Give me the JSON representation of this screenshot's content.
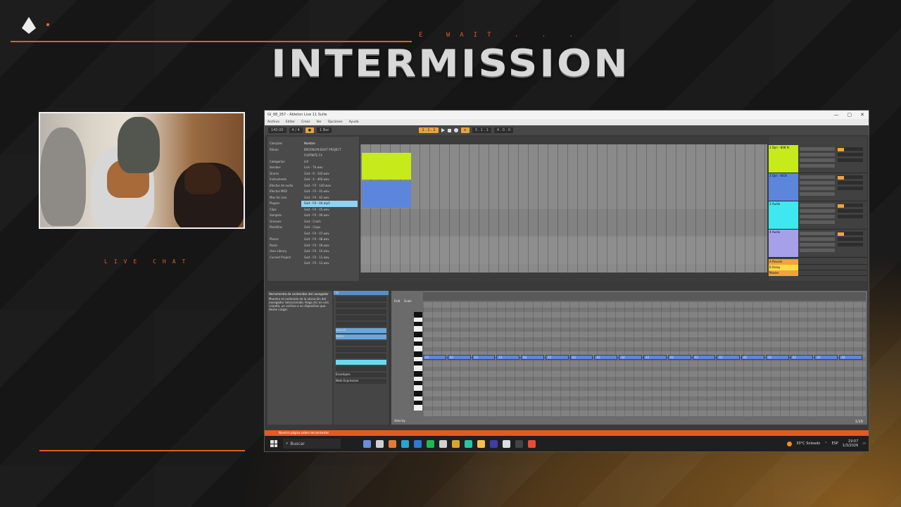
{
  "overlay": {
    "subtitle": "E WAIT . . .",
    "title": "INTERMISSION",
    "live_chat": "LIVE CHAT",
    "accent_color": "#e45b22"
  },
  "window": {
    "title": "Gl_98_267 - Ableton Live 11 Suite",
    "controls": [
      "—",
      "▢",
      "✕"
    ]
  },
  "menu": [
    "Archivo",
    "Editar",
    "Crear",
    "Ver",
    "Opciones",
    "Ayuda"
  ],
  "transport": {
    "tempo": "140.00",
    "signature": "4 / 4",
    "position": "1 . 1 . 1",
    "loop_start": "3 . 1 . 1",
    "loop_length": "4 . 0 . 0",
    "quantize": "1 Bar"
  },
  "browser": {
    "categories": [
      "Coleções",
      "Rótulo",
      "",
      "Categorías",
      "Sonidos",
      "Drums",
      "Instruments",
      "Efectos de audio",
      "Efectos MIDI",
      "Max for Live",
      "Plugins",
      "Clips",
      "Samples",
      "Grooves",
      "Plantillas",
      "",
      "Places",
      "Packs",
      "User Library",
      "Current Project"
    ],
    "files_header": "Nombre",
    "files": [
      "BROOKLYN BUUT PROJECT",
      "FORTNITE FX",
      "LIX",
      "Lion - Tb.wav",
      "Gait - 6 - 140.wav",
      "Gait - 4 - 460.wav",
      "Gait - FX - 140.wav",
      "Gait - FX - 01.wav",
      "Gait - FX - 02.wav",
      "Gait - FX - 04.mp3",
      "Gait - FX - 05.wav",
      "Gait - FX - 06.wav",
      "Gait - Crash",
      "Gait - Claps",
      "Gait - FX - 07.wav",
      "Gait - FX - 08.wav",
      "Gait - FX - 09.wav",
      "Gait - FX - 10.wav",
      "Gait - FX - 11.wav",
      "Gait - FX - 12.wav"
    ],
    "selected_index": 9
  },
  "mixer": {
    "tracks": [
      {
        "name": "1 Dyn - 808 N",
        "color": "#c6ea1a"
      },
      {
        "name": "2 Dyn - KICK",
        "color": "#5b86dc"
      },
      {
        "name": "3 Audio",
        "color": "#3fe8f0"
      },
      {
        "name": "4 Audio",
        "color": "#a6a0e8"
      }
    ],
    "returns": [
      {
        "name": "A Reverb",
        "color": "#f2a33a"
      },
      {
        "name": "B Delay",
        "color": "#ffd84a"
      },
      {
        "name": "Master",
        "color": "#f2a33a"
      }
    ]
  },
  "clip": {
    "info_title": "Herramienta de contenidos del navegador",
    "info_text": "Muestra el contenido de la ubicación del navegador seleccionada. Haga clic en una carpeta, un archivo o un dispositivo que desee cargar.",
    "panel_header": "Clip",
    "notes_header": "Notes",
    "launch_header": "Launch",
    "envelopes": "Envelopes",
    "note_expression": "Note Expression"
  },
  "midi_editor": {
    "fold": "Fold",
    "scale": "Scale",
    "note_label": "A2",
    "velocity": "Velocity",
    "grid_fraction": "1/16",
    "note_count": 18
  },
  "status": {
    "text": "Nuestra página sobre herramientas"
  },
  "taskbar": {
    "search": "Buscar",
    "weather": "30°C Soleado",
    "language": "ESP",
    "time": "19:07",
    "date": "1/3/2026"
  }
}
